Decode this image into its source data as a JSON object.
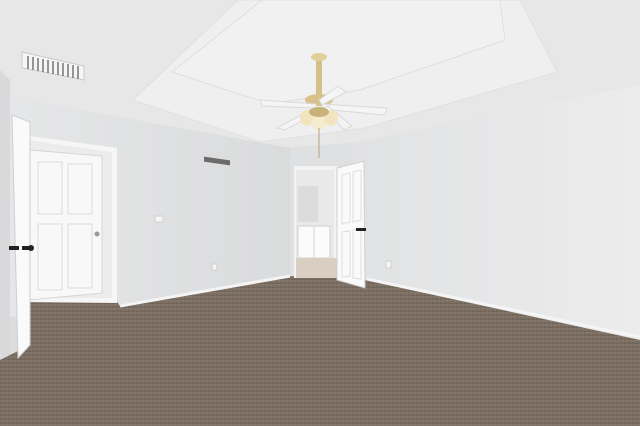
{
  "scene": {
    "room": "empty-bedroom",
    "floor": "carpet",
    "ceiling": "tray-ceiling",
    "fixtures": [
      "ceiling-fan-with-light",
      "hvac-vent",
      "return-vent"
    ],
    "doors": [
      "open-left-door",
      "closet-door",
      "bathroom-door"
    ]
  },
  "colors": {
    "wall_left": "#e4e5e6",
    "wall_right": "#e9eaeb",
    "wall_back": "#dfe0e1",
    "ceiling": "#eeeeee",
    "carpet": "#786a5e",
    "door": "#f7f7f7",
    "trim": "#f4f4f4",
    "fan_brass": "#d8c28a"
  }
}
